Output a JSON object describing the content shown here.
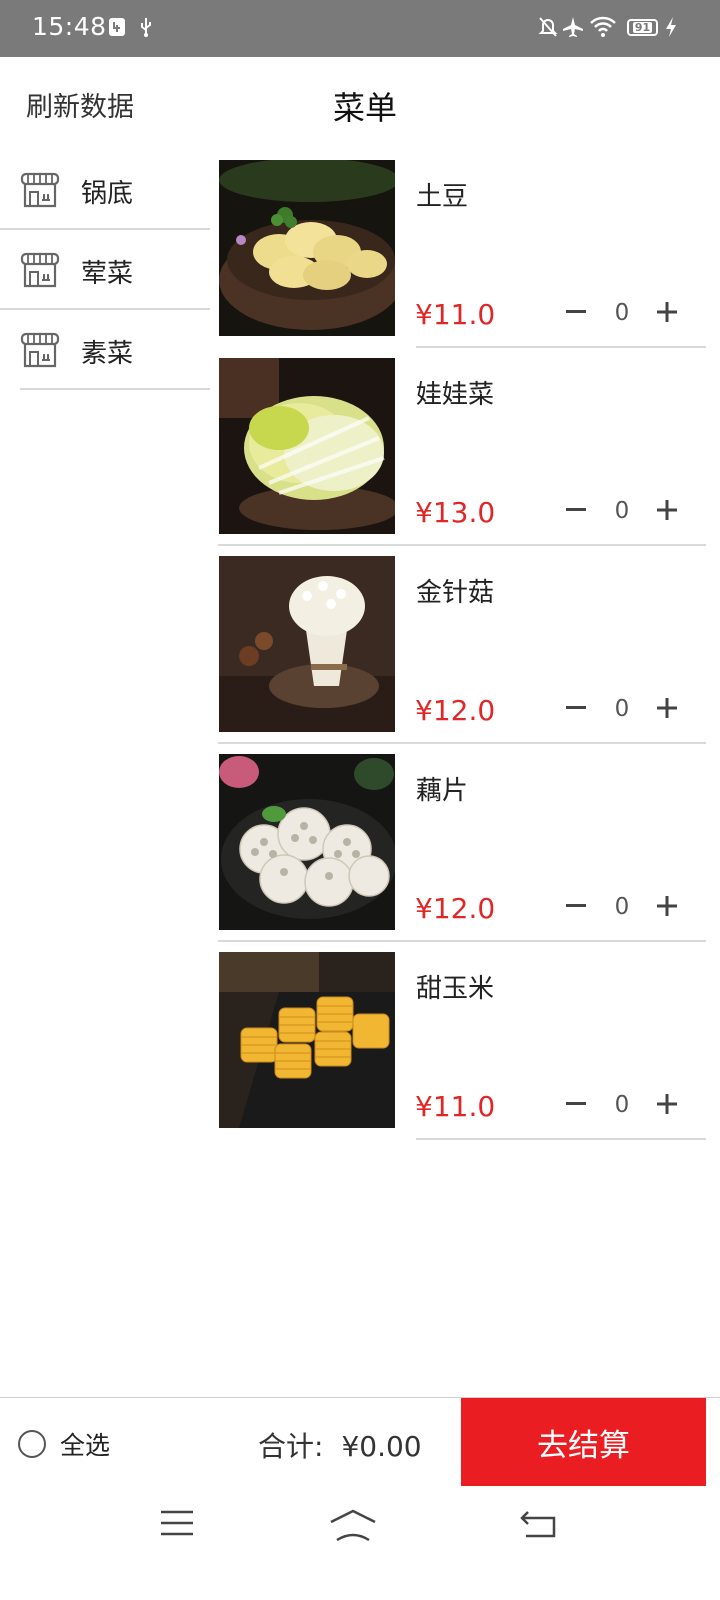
{
  "status_bar": {
    "time": "15:48",
    "battery": "91",
    "icons": [
      "usb-debug-icon",
      "usb-icon",
      "silent-icon",
      "airplane-icon",
      "wifi-icon",
      "battery-icon",
      "charging-icon"
    ]
  },
  "header": {
    "refresh_label": "刷新数据",
    "title": "菜单"
  },
  "sidebar": {
    "items": [
      {
        "label": "锅底",
        "icon": "store-icon"
      },
      {
        "label": "荤菜",
        "icon": "store-icon"
      },
      {
        "label": "素菜",
        "icon": "store-icon"
      }
    ]
  },
  "products": [
    {
      "name": "土豆",
      "price": "¥11.0",
      "qty": "0",
      "image": "potato-image"
    },
    {
      "name": "娃娃菜",
      "price": "¥13.0",
      "qty": "0",
      "image": "baby-cabbage-image"
    },
    {
      "name": "金针菇",
      "price": "¥12.0",
      "qty": "0",
      "image": "enoki-mushroom-image"
    },
    {
      "name": "藕片",
      "price": "¥12.0",
      "qty": "0",
      "image": "lotus-root-image"
    },
    {
      "name": "甜玉米",
      "price": "¥11.0",
      "qty": "0",
      "image": "sweet-corn-image"
    }
  ],
  "cart": {
    "select_all_label": "全选",
    "total_label": "合计:",
    "total_amount": "¥0.00",
    "checkout_label": "去结算"
  },
  "colors": {
    "accent": "#ea1d22",
    "price": "#e02727",
    "status_bar": "#7a7a7a"
  }
}
